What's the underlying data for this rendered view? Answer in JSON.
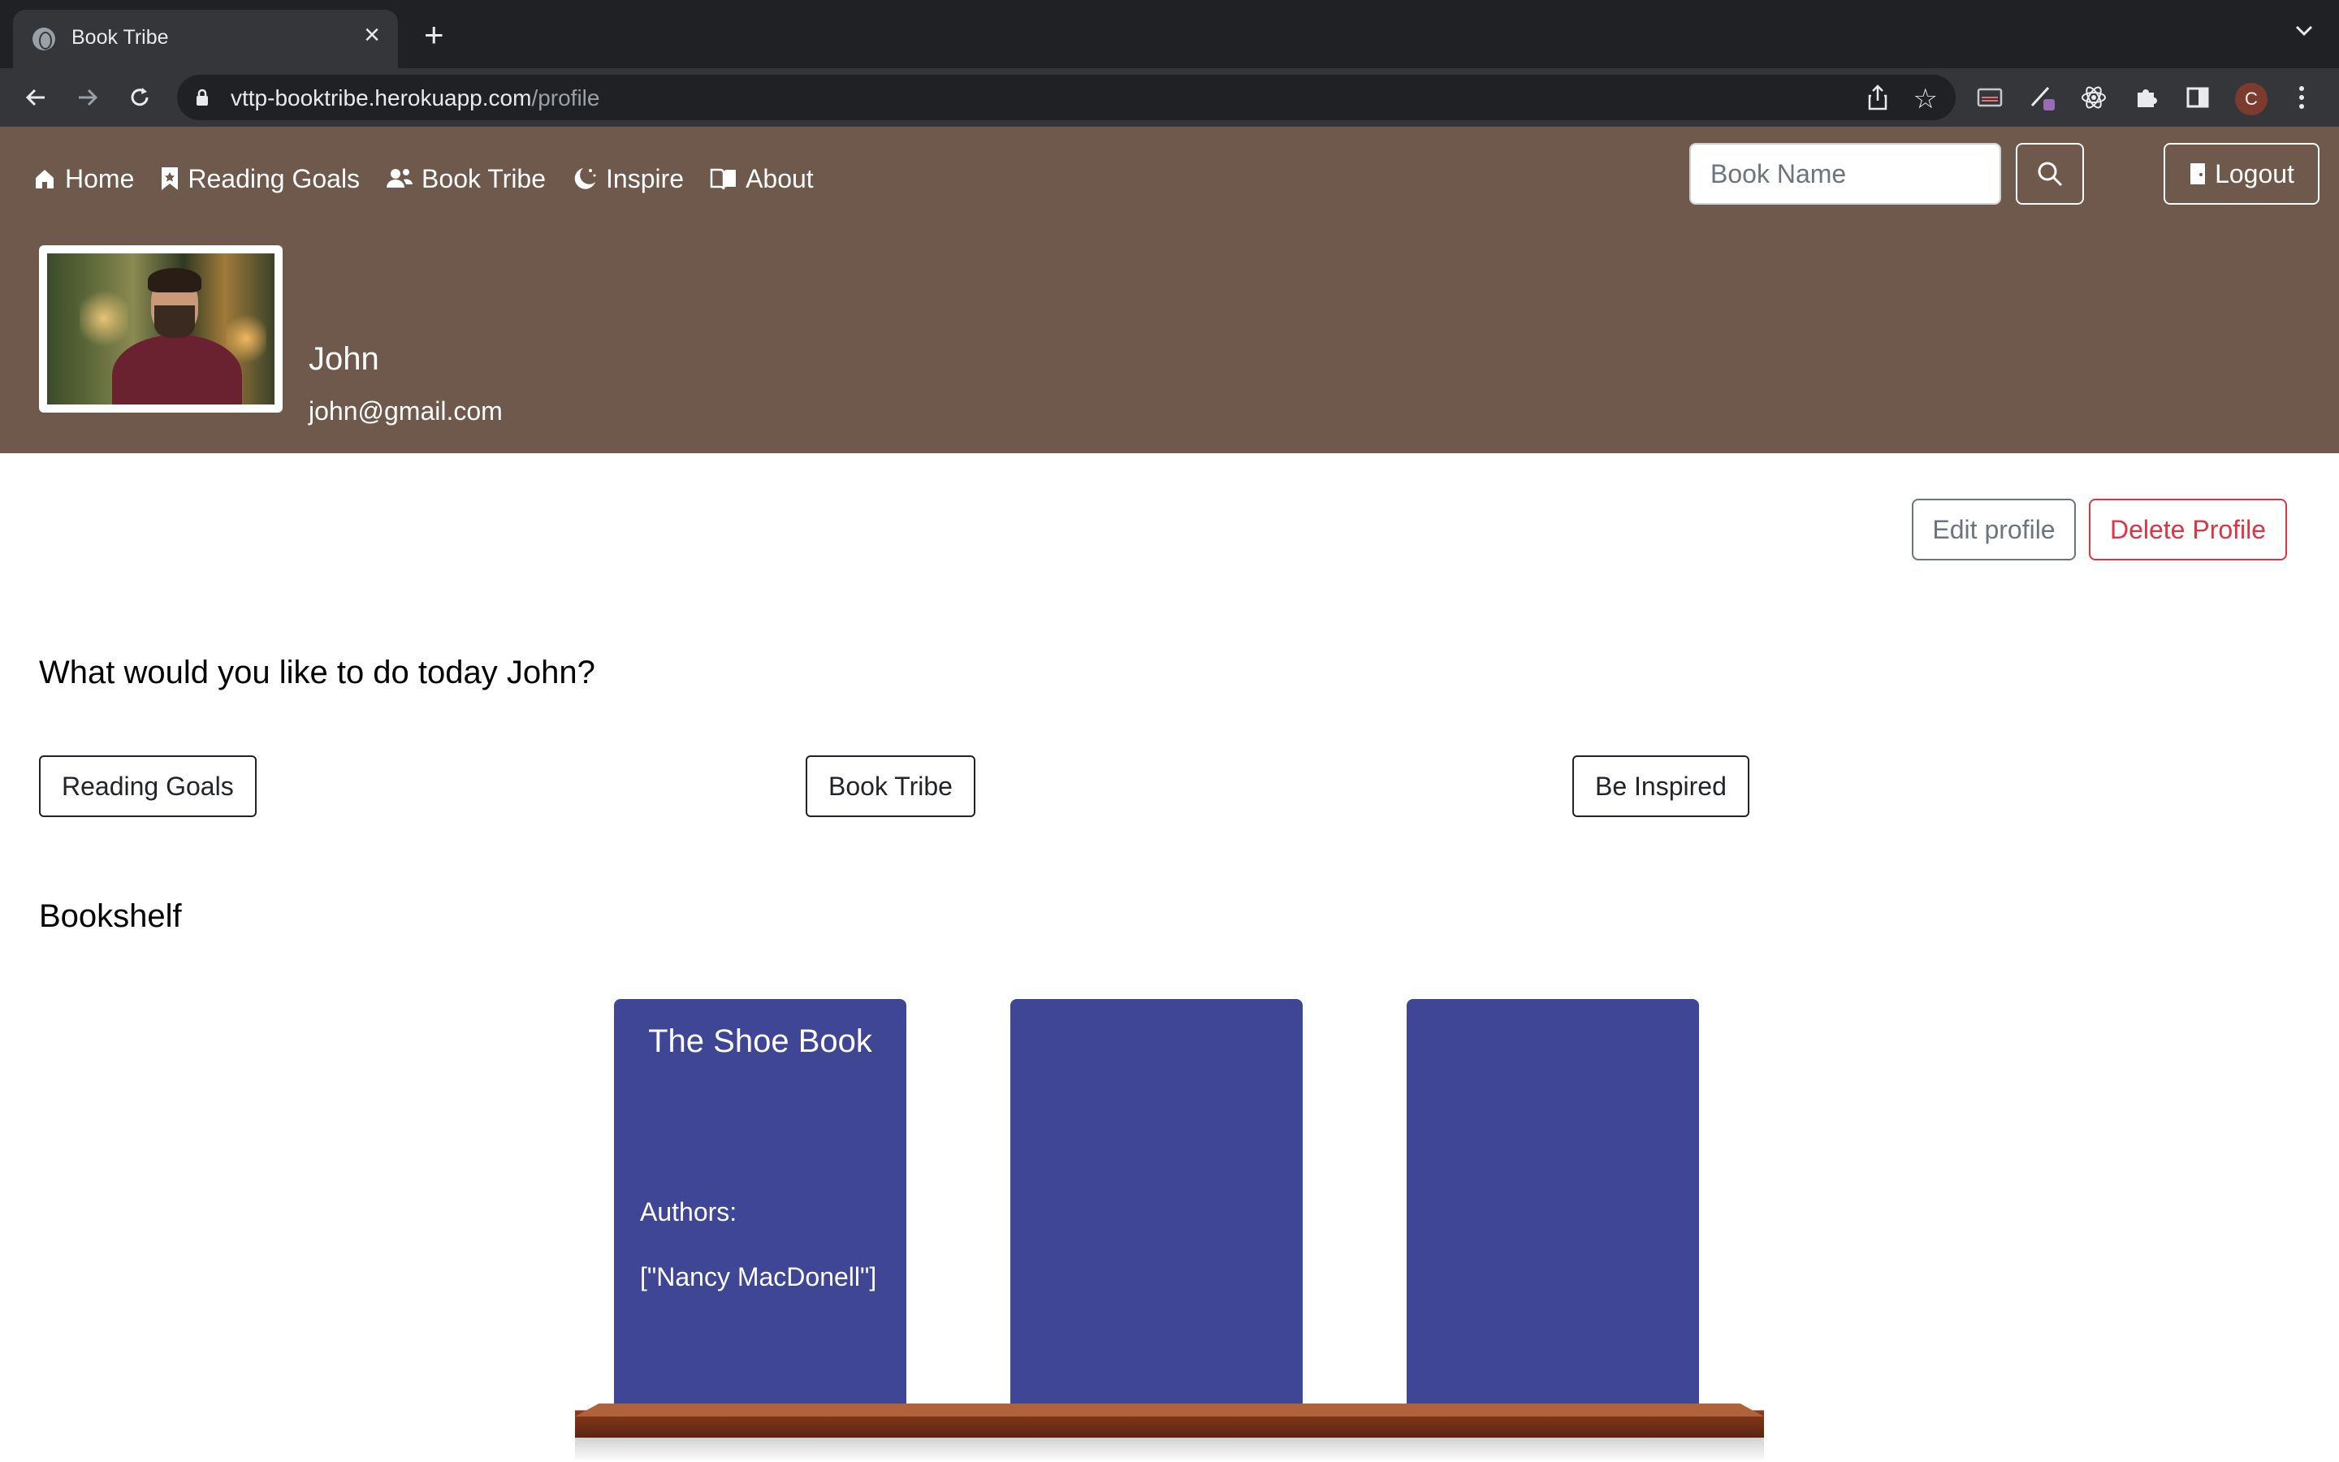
{
  "browser": {
    "tab_title": "Book Tribe",
    "url_host": "vttp-booktribe.herokuapp.com",
    "url_path": "/profile",
    "profile_initial": "C"
  },
  "navbar": {
    "items": [
      {
        "label": "Home",
        "icon": "home-icon"
      },
      {
        "label": "Reading Goals",
        "icon": "bookmark-icon"
      },
      {
        "label": "Book Tribe",
        "icon": "users-icon"
      },
      {
        "label": "Inspire",
        "icon": "moon-stars-icon"
      },
      {
        "label": "About",
        "icon": "book-open-icon"
      }
    ],
    "search_placeholder": "Book Name",
    "logout_label": "Logout",
    "bg_color": "#6e594c"
  },
  "profile": {
    "name": "John",
    "email": "john@gmail.com"
  },
  "actions": {
    "edit_label": "Edit profile",
    "delete_label": "Delete Profile"
  },
  "main": {
    "greeting": "What would you like to do today John?",
    "quick_links": [
      "Reading Goals",
      "Book Tribe",
      "Be Inspired"
    ],
    "bookshelf_heading": "Bookshelf"
  },
  "bookshelf": {
    "book_color": "#3e4695",
    "books": [
      {
        "title": "The Shoe Book",
        "authors_label": "Authors:",
        "authors": "[\"Nancy MacDonell\"]"
      },
      {
        "title": "",
        "authors_label": "",
        "authors": ""
      },
      {
        "title": "",
        "authors_label": "",
        "authors": ""
      }
    ]
  }
}
